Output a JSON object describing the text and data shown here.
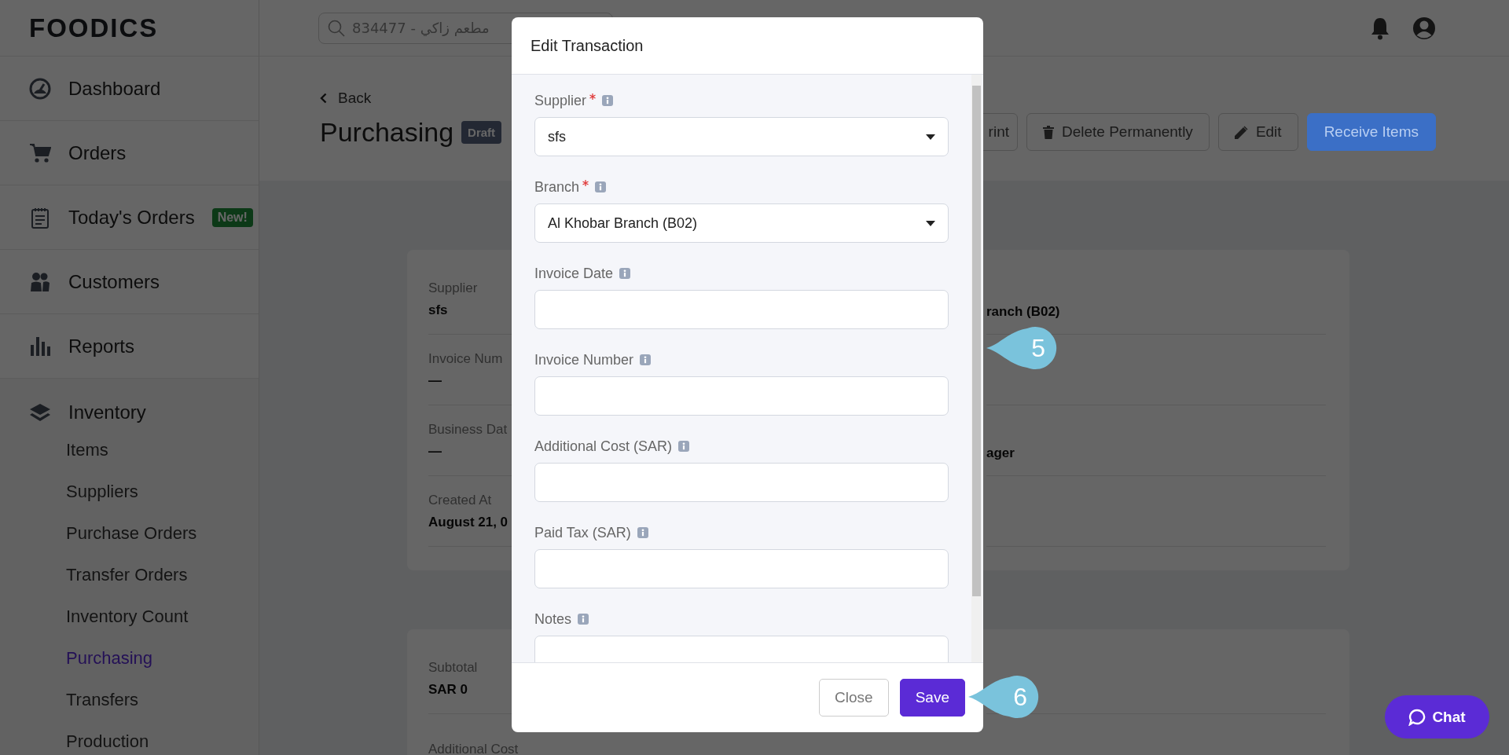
{
  "logo": "FOODICS",
  "search": {
    "placeholder": "834477 - مطعم زاكي"
  },
  "sidebar": {
    "items": [
      {
        "label": "Dashboard",
        "selected": false
      },
      {
        "label": "Orders",
        "selected": false
      },
      {
        "label": "Today's Orders",
        "badge": "New!",
        "selected": false
      },
      {
        "label": "Customers",
        "selected": false
      },
      {
        "label": "Reports",
        "selected": false
      },
      {
        "label": "Inventory",
        "selected": false,
        "children": [
          {
            "label": "Items",
            "selected": false
          },
          {
            "label": "Suppliers",
            "selected": false
          },
          {
            "label": "Purchase Orders",
            "selected": false
          },
          {
            "label": "Transfer Orders",
            "selected": false
          },
          {
            "label": "Inventory Count",
            "selected": false
          },
          {
            "label": "Purchasing",
            "selected": true
          },
          {
            "label": "Transfers",
            "selected": false
          },
          {
            "label": "Production",
            "selected": false
          }
        ]
      }
    ]
  },
  "header": {
    "back": "Back",
    "title": "Purchasing",
    "status": "Draft",
    "actions": [
      {
        "label": "rint",
        "kind": "plain"
      },
      {
        "label": "Delete Permanently",
        "kind": "delete"
      },
      {
        "label": "Edit",
        "kind": "edit"
      },
      {
        "label": "Receive Items",
        "kind": "primary"
      }
    ]
  },
  "details": {
    "left": [
      {
        "label": "Supplier",
        "value": "sfs"
      },
      {
        "label": "Invoice Num",
        "value": "—"
      },
      {
        "label": "Business Dat",
        "value": "—"
      },
      {
        "label": "Created At",
        "value": "August 21, 0"
      }
    ],
    "right": [
      {
        "value": "ranch (B02)"
      },
      {
        "value": "ager"
      }
    ]
  },
  "totals": [
    {
      "label": "Subtotal",
      "value": "SAR 0"
    },
    {
      "label": "Additional Cost"
    }
  ],
  "modal": {
    "title": "Edit Transaction",
    "fields": [
      {
        "label": "Supplier",
        "required": true,
        "kind": "select",
        "value": "sfs"
      },
      {
        "label": "Branch",
        "required": true,
        "kind": "select",
        "value": "Al Khobar Branch (B02)"
      },
      {
        "label": "Invoice Date",
        "required": false,
        "kind": "text"
      },
      {
        "label": "Invoice Number",
        "required": false,
        "kind": "text"
      },
      {
        "label": "Additional Cost (SAR)",
        "required": false,
        "kind": "text"
      },
      {
        "label": "Paid Tax (SAR)",
        "required": false,
        "kind": "text"
      },
      {
        "label": "Notes",
        "required": false,
        "kind": "text"
      }
    ],
    "buttons": [
      {
        "label": "Close",
        "kind": "secondary"
      },
      {
        "label": "Save",
        "kind": "primary"
      }
    ]
  },
  "callouts": [
    "5",
    "6"
  ],
  "chat": "Chat"
}
